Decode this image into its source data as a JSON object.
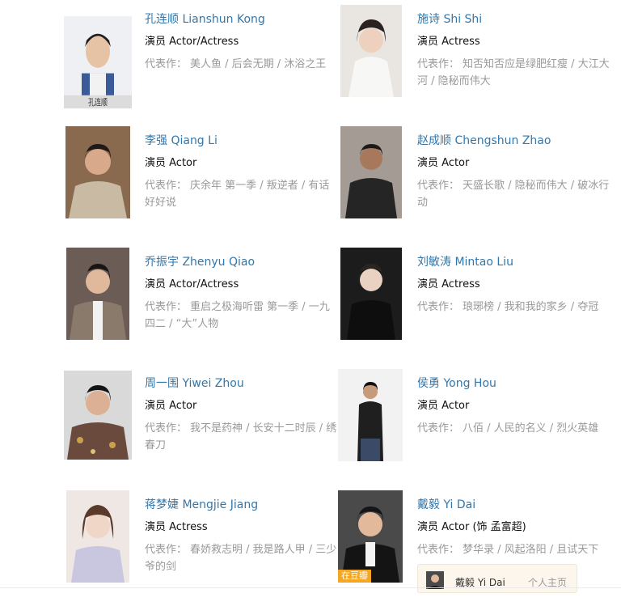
{
  "works_label": "代表作：",
  "actors": [
    {
      "name": "孔连顺 Lianshun Kong",
      "role": "演员 Actor/Actress",
      "works": "美人鱼 / 后会无期 / 沐浴之王",
      "photo_caption": "孔连顺"
    },
    {
      "name": "施诗 Shi Shi",
      "role": "演员 Actress",
      "works": "知否知否应是绿肥红瘦 / 大江大河 / 隐秘而伟大"
    },
    {
      "name": "李强 Qiang Li",
      "role": "演员 Actor",
      "works": "庆余年 第一季 / 叛逆者 / 有话好好说"
    },
    {
      "name": "赵成顺 Chengshun Zhao",
      "role": "演员 Actor",
      "works": "天盛长歌 / 隐秘而伟大 / 破冰行动"
    },
    {
      "name": "乔振宇 Zhenyu Qiao",
      "role": "演员 Actor/Actress",
      "works": "重启之极海听雷 第一季 / 一九四二 / “大”人物"
    },
    {
      "name": "刘敏涛 Mintao Liu",
      "role": "演员 Actress",
      "works": "琅琊榜 / 我和我的家乡 / 夺冠"
    },
    {
      "name": "周一围 Yiwei Zhou",
      "role": "演员 Actor",
      "works": "我不是药神 / 长安十二时辰 / 绣春刀"
    },
    {
      "name": "侯勇 Yong Hou",
      "role": "演员 Actor",
      "works": "八佰 / 人民的名义 / 烈火英雄"
    },
    {
      "name": "蒋梦婕 Mengjie Jiang",
      "role": "演员 Actress",
      "works": "春娇救志明 / 我是路人甲 / 三少爷的剑"
    },
    {
      "name": "戴毅 Yi Dai",
      "role": "演员 Actor (饰 孟富超)",
      "works": "梦华录 / 风起洛阳 / 且试天下",
      "badge": "在豆瓣"
    }
  ],
  "popup": {
    "name": "戴毅 Yi Dai",
    "link": "个人主页"
  }
}
